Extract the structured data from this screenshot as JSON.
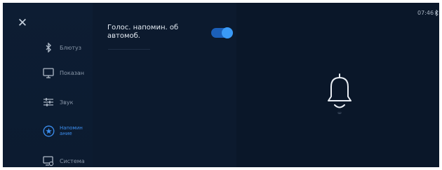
{
  "status_bar": {
    "time": "07:46",
    "bluetooth_icon": "bluetooth-icon"
  },
  "close_icon": "close-icon",
  "sidebar": {
    "items": [
      {
        "label": "Блютуз",
        "icon": "bluetooth-icon",
        "active": false
      },
      {
        "label": "Показан",
        "icon": "display-icon",
        "active": false
      },
      {
        "label": "Звук",
        "icon": "equalizer-icon",
        "active": false
      },
      {
        "label": "Напомин\nание",
        "icon": "reminder-icon",
        "active": true
      },
      {
        "label": "Система",
        "icon": "system-icon",
        "active": false
      }
    ]
  },
  "settings": {
    "voice_reminder": {
      "label": "Голос. напомин. об автомоб.",
      "enabled": true
    }
  },
  "illustration": {
    "icon": "bell-icon"
  },
  "colors": {
    "background": "#0a1729",
    "accent": "#3a9af7",
    "text": "#e6edf5",
    "muted": "#8896a8"
  }
}
